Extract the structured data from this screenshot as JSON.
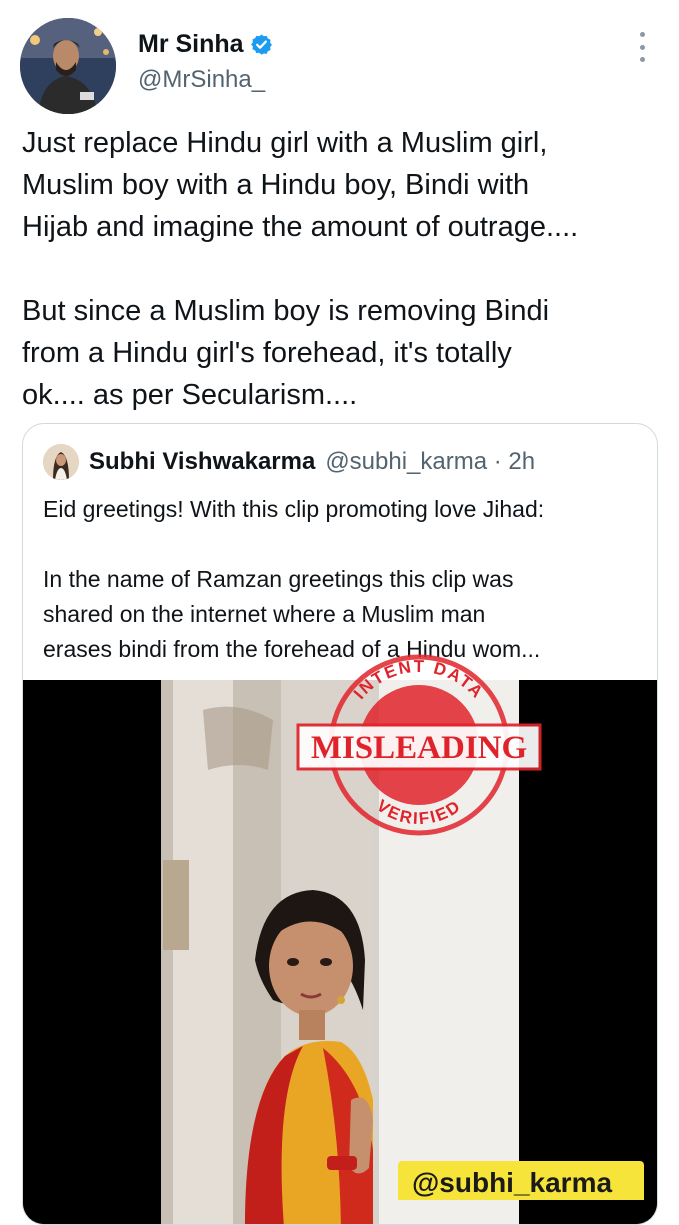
{
  "tweet": {
    "display_name": "Mr Sinha",
    "handle": "@MrSinha_",
    "text": "Just replace Hindu girl with a Muslim girl,\nMuslim boy with a Hindu boy, Bindi with\nHijab and imagine the amount of outrage....\n\nBut since a Muslim boy is removing Bindi\nfrom a Hindu girl's forehead, it's totally\nok.... as per Secularism...."
  },
  "quote": {
    "display_name": "Subhi Vishwakarma",
    "handle_time": "@subhi_karma · 2h",
    "text": "Eid greetings! With this clip promoting love Jihad:\n\nIn the name of Ramzan greetings this clip was\nshared on the internet where a Muslim man\nerases bindi from the forehead of a Hindu wom..."
  },
  "media": {
    "watermark": "@subhi_karma"
  },
  "stamp": {
    "top_arc": "INTENT DATA",
    "center": "MISLEADING",
    "bottom_arc": "VERIFIED",
    "color": "#e0232b"
  },
  "icons": {
    "verified": "verified-badge-icon",
    "more": "more-options-icon"
  },
  "colors": {
    "verified_blue": "#1d9bf0",
    "text_primary": "#0f1419",
    "text_secondary": "#536471",
    "border": "#cfd9de"
  }
}
